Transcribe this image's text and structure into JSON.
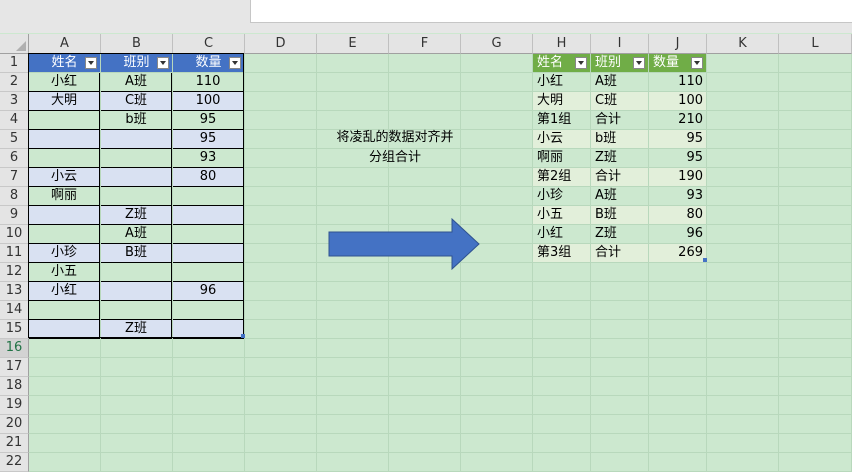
{
  "columns": [
    "A",
    "B",
    "C",
    "D",
    "E",
    "F",
    "G",
    "H",
    "I",
    "J",
    "K",
    "L"
  ],
  "rows": [
    "1",
    "2",
    "3",
    "4",
    "5",
    "6",
    "7",
    "8",
    "9",
    "10",
    "11",
    "12",
    "13",
    "14",
    "15",
    "16",
    "17",
    "18",
    "19",
    "20",
    "21",
    "22"
  ],
  "left_table": {
    "headers": [
      "姓名",
      "班别",
      "数量"
    ],
    "rows": [
      [
        "小红",
        "A班",
        "110"
      ],
      [
        "大明",
        "C班",
        "100"
      ],
      [
        "",
        "b班",
        "95"
      ],
      [
        "",
        "",
        "95"
      ],
      [
        "",
        "",
        "93"
      ],
      [
        "小云",
        "",
        "80"
      ],
      [
        "啊丽",
        "",
        ""
      ],
      [
        "",
        "Z班",
        ""
      ],
      [
        "",
        "A班",
        ""
      ],
      [
        "小珍",
        "B班",
        ""
      ],
      [
        "小五",
        "",
        ""
      ],
      [
        "小红",
        "",
        "96"
      ],
      [
        "",
        "",
        ""
      ],
      [
        "",
        "Z班",
        ""
      ]
    ]
  },
  "note_lines": [
    "将凌乱的数据对齐并",
    "分组合计"
  ],
  "arrow_color": "#4472c4",
  "right_table": {
    "headers": [
      "姓名",
      "班别",
      "数量"
    ],
    "rows": [
      [
        "小红",
        "A班",
        "110"
      ],
      [
        "大明",
        "C班",
        "100"
      ],
      [
        "第1组",
        "合计",
        "210"
      ],
      [
        "小云",
        "b班",
        "95"
      ],
      [
        "啊丽",
        "Z班",
        "95"
      ],
      [
        "第2组",
        "合计",
        "190"
      ],
      [
        "小珍",
        "A班",
        "93"
      ],
      [
        "小五",
        "B班",
        "80"
      ],
      [
        "小红",
        "Z班",
        "96"
      ],
      [
        "第3组",
        "合计",
        "269"
      ]
    ]
  },
  "selected_row": "16"
}
